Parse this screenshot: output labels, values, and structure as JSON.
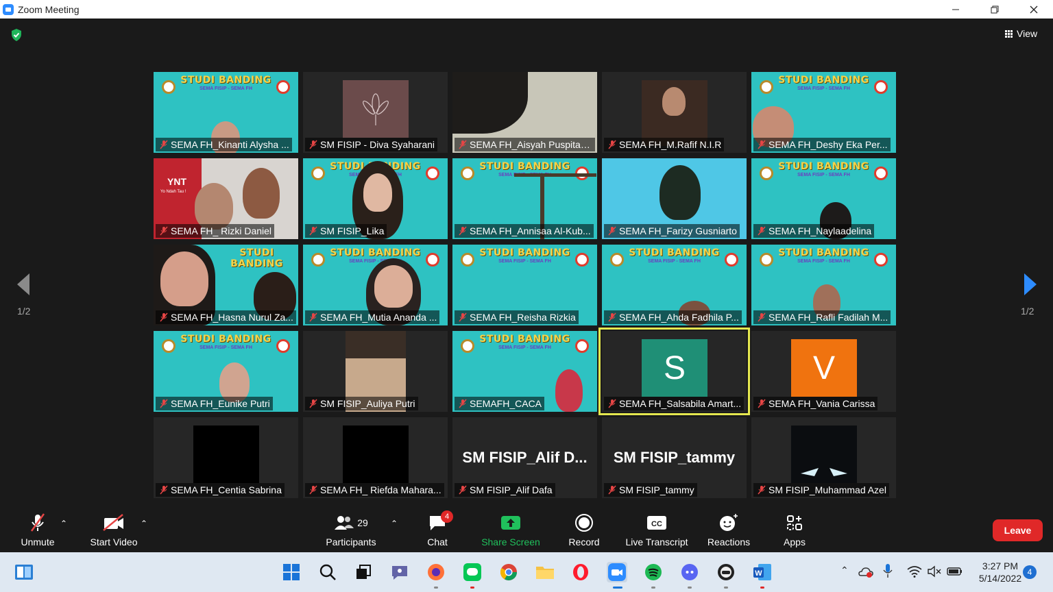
{
  "window": {
    "title": "Zoom Meeting"
  },
  "top": {
    "view_label": "View"
  },
  "pager": {
    "left": "1/2",
    "right": "1/2"
  },
  "banner": {
    "title": "STUDI BANDING",
    "subtitle": "SEMA FISIP - SEMA FH"
  },
  "tiles": [
    {
      "name": "SEMA FH_Kinanti Alysha ..."
    },
    {
      "name": "SM FISIP - Diva Syaharani"
    },
    {
      "name": "SEMA FH_Aisyah Puspitas..."
    },
    {
      "name": "SEMA FH_M.Rafif N.I.R"
    },
    {
      "name": "SEMA FH_Deshy Eka Per..."
    },
    {
      "name": "SEMA FH_ Rizki Daniel"
    },
    {
      "name": "SM FISIP_Lika"
    },
    {
      "name": "SEMA FH_Annisaa Al-Kub..."
    },
    {
      "name": "SEMA FH_Farizy Gusniarto"
    },
    {
      "name": "SEMA FH_Naylaadelina"
    },
    {
      "name": "SEMA FH_Hasna Nurul Za..."
    },
    {
      "name": "SEMA FH_Mutia Ananda ..."
    },
    {
      "name": "SEMA FH_Reisha Rizkia"
    },
    {
      "name": "SEMA FH_Ahda Fadhila P..."
    },
    {
      "name": "SEMA FH_Rafli Fadilah M..."
    },
    {
      "name": "SEMA FH_Eunike Putri"
    },
    {
      "name": "SM FISIP_Auliya Putri"
    },
    {
      "name": "SEMAFH_CACA"
    },
    {
      "name": "SEMA FH_Salsabila Amart...",
      "avatar": "S"
    },
    {
      "name": "SEMA FH_Vania Carissa",
      "avatar": "V"
    },
    {
      "name": "SEMA FH_Centia Sabrina"
    },
    {
      "name": "SEMA FH_ Riefda Mahara..."
    },
    {
      "name": "SM FISIP_Alif Dafa",
      "big": "SM FISIP_Alif D..."
    },
    {
      "name": "SM FISIP_tammy",
      "big": "SM FISIP_tammy"
    },
    {
      "name": "SM FISIP_Muhammad Azel"
    }
  ],
  "rizki_overlay": {
    "line1": "YNT",
    "line2": "Yo Ndah Tau !"
  },
  "toolbar": {
    "unmute": "Unmute",
    "start_video": "Start Video",
    "participants": "Participants",
    "participants_count": "29",
    "chat": "Chat",
    "chat_badge": "4",
    "share_screen": "Share Screen",
    "record": "Record",
    "live_transcript": "Live Transcript",
    "reactions": "Reactions",
    "apps": "Apps",
    "leave": "Leave"
  },
  "taskbar": {
    "time": "3:27 PM",
    "date": "5/14/2022",
    "notifications": "4"
  },
  "colors": {
    "zoom_blue": "#2D8CFF",
    "banner_teal": "#2ec2c2",
    "leave_red": "#e02828",
    "share_green": "#20c05c",
    "active_speaker": "#e5e84f"
  }
}
